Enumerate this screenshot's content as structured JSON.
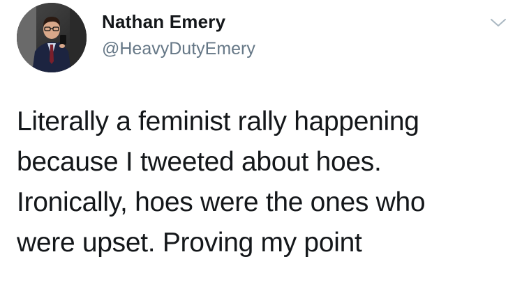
{
  "tweet": {
    "author": {
      "display_name": "Nathan Emery",
      "handle": "@HeavyDutyEmery",
      "avatar_icon": "profile-photo"
    },
    "menu_icon": "chevron-down-icon",
    "text_lines": [
      "Literally a feminist rally happening",
      "because I tweeted about hoes.",
      "Ironically, hoes were the ones who",
      "were upset. Proving my point"
    ],
    "colors": {
      "text": "#14171a",
      "secondary": "#657786",
      "chevron": "#aab8c2"
    }
  }
}
